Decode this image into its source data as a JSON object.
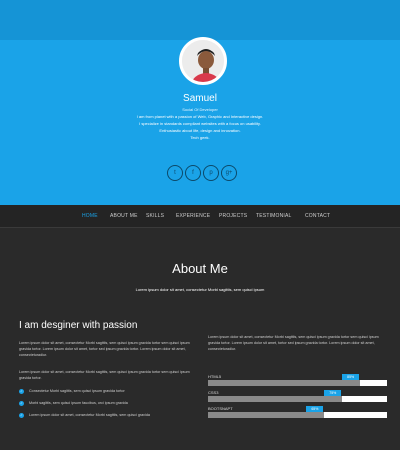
{
  "hero": {
    "name": "Samuel",
    "role": "Social Of Developer",
    "bio_lines": [
      "I am from planet with a passion of Web, Graphic and Interactive design.",
      "I specialize in standards compliant websites with a focus on usability.",
      "Enthusiastic about life, design and innovation.",
      "Tech geek."
    ],
    "socials": [
      {
        "icon": "twitter-icon",
        "glyph": "t"
      },
      {
        "icon": "facebook-icon",
        "glyph": "f"
      },
      {
        "icon": "pinterest-icon",
        "glyph": "p"
      },
      {
        "icon": "google-plus-icon",
        "glyph": "g+"
      }
    ]
  },
  "nav": {
    "items": [
      "HOME",
      "ABOUT ME",
      "SKILLS",
      "EXPERIENCE",
      "PROJECTS",
      "TESTIMONIAL",
      "CONTACT"
    ],
    "active": "HOME"
  },
  "about": {
    "title": "About Me",
    "subtitle": "Lorem ipsum dolor sit amet, consectetur Morbi sagittis, sem quisci ipsum",
    "left": {
      "heading": "I am desginer with passion",
      "para1": "Lorem ipsum dolor sit amet, consectetur Morbi sagittis, sem quisci ipsum gravida tortor sem quisci ipsum gravida tortor. Lorem ipsum dolor sit amet, tortor sed ipsum gravida tortor. Lorem ipsum dolor sit amet, consecteturadiur.",
      "para2": "Lorem ipsum dolor sit amet, consectetur Morbi sagittis, sem quisci ipsum gravida tortor sem quisci ipsum gravida tortor.",
      "bullets": [
        "Consectetur Morbi sagittis, sem quisci ipsum gravida tortor",
        "Morbi sagittis, sem quisci ipsum faucibus, orci ipsum gravida",
        "Lorem ipsum dolor sit amet, consectetur Morbi sagittis, sem quisci gravida"
      ]
    },
    "right": {
      "para": "Lorem ipsum dolor sit amet, consectetur Morbi sagittis, sem quisci ipsum gravida tortor sem quisci ipsum gravida tortor. Lorem ipsum dolor sit amet, tortor sed ipsum gravida tortor. Lorem ipsum dolor sit amet, consecteturadiur.",
      "skills": [
        {
          "label": "HTML5",
          "percent": 85,
          "tag": "85%"
        },
        {
          "label": "CSS3",
          "percent": 75,
          "tag": "75%"
        },
        {
          "label": "BOOTSNAPT",
          "percent": 65,
          "tag": "65%"
        }
      ]
    }
  },
  "colors": {
    "accent": "#1aa3e8",
    "dark_bg": "#2a2a2a"
  }
}
